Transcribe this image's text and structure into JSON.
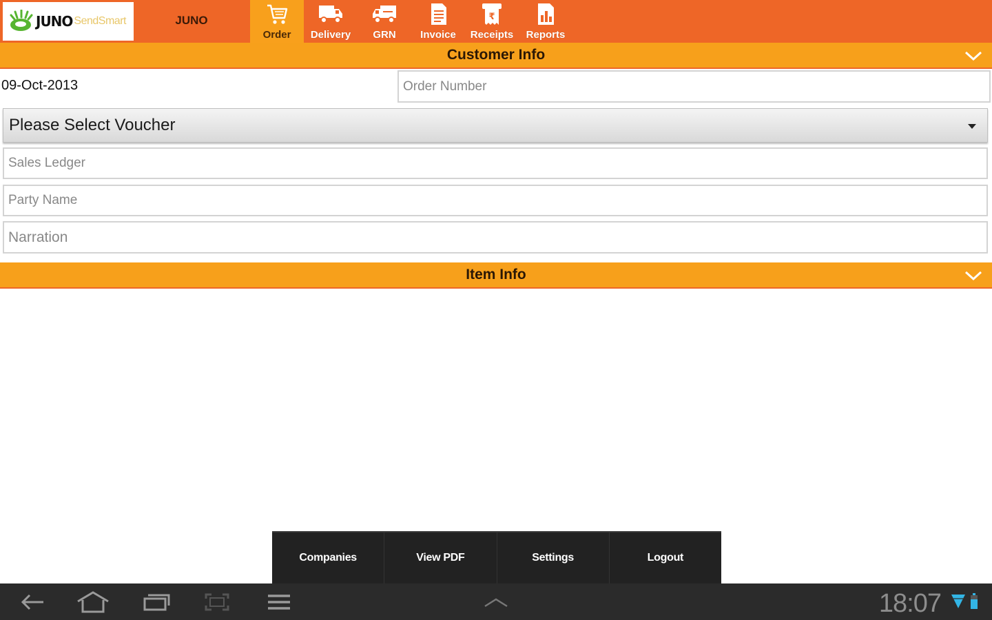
{
  "app": {
    "logo_brand": "JUNO",
    "logo_tagline": "SendSmart",
    "company_name": "JUNO"
  },
  "tabs": [
    {
      "label": "Order",
      "icon": "cart-icon",
      "active": true
    },
    {
      "label": "Delivery",
      "icon": "delivery-truck-icon",
      "active": false
    },
    {
      "label": "GRN",
      "icon": "grn-truck-icon",
      "active": false
    },
    {
      "label": "Invoice",
      "icon": "invoice-icon",
      "active": false
    },
    {
      "label": "Receipts",
      "icon": "receipt-icon",
      "active": false
    },
    {
      "label": "Reports",
      "icon": "reports-icon",
      "active": false
    }
  ],
  "customer_section": {
    "title": "Customer Info",
    "date": "09-Oct-2013",
    "order_number_placeholder": "Order Number",
    "voucher_select": "Please Select Voucher",
    "sales_ledger_placeholder": "Sales Ledger",
    "party_name_placeholder": "Party Name",
    "narration_placeholder": "Narration"
  },
  "item_section": {
    "title": "Item Info"
  },
  "options_menu": {
    "companies": "Companies",
    "view_pdf": "View PDF",
    "settings": "Settings",
    "logout": "Logout"
  },
  "system_bar": {
    "time": "18:07"
  },
  "colors": {
    "topbar": "#ee6627",
    "section_bar": "#f7a01b",
    "active_tab": "#f8a01c",
    "menu_bg": "#222222",
    "navbar_bg": "#2b2b2b"
  }
}
